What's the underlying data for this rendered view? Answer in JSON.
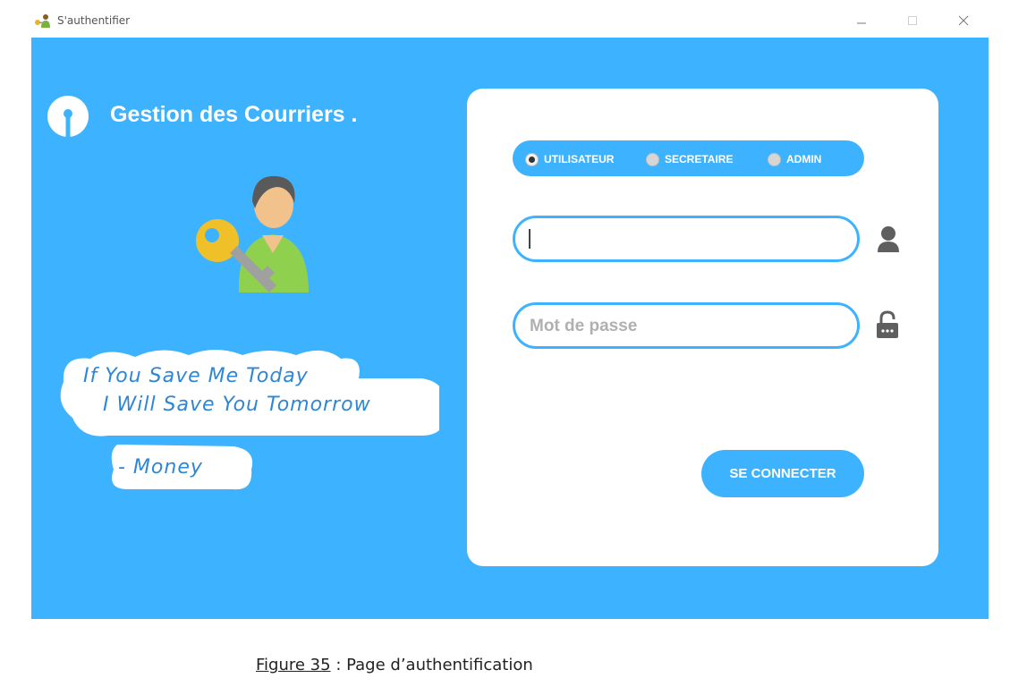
{
  "window": {
    "title": "S'authentifier",
    "icons": [
      "users-key-icon",
      "minimize-icon",
      "maximize-icon",
      "close-icon"
    ]
  },
  "brand": {
    "title": "Gestion des Courriers  .",
    "logo_icon": "keyhole-logo-icon",
    "illustration_icon": "user-key-icon"
  },
  "quote": {
    "line1": "If You Save Me Today",
    "line2": "I Will Save You Tomorrow",
    "author": "- Money"
  },
  "login": {
    "roles": [
      {
        "label": "UTILISATEUR",
        "selected": true
      },
      {
        "label": "SECRETAIRE",
        "selected": false
      },
      {
        "label": "ADMIN",
        "selected": false
      }
    ],
    "username": {
      "value": "",
      "placeholder": "",
      "icon": "user-icon"
    },
    "password": {
      "value": "",
      "placeholder": "Mot de passe",
      "icon": "lock-icon"
    },
    "submit_label": "SE CONNECTER"
  },
  "caption": {
    "label": "Figure 35",
    "text": " : Page d’authentification"
  },
  "colors": {
    "accent": "#3db3ff",
    "card": "#ffffff",
    "quote_text": "#2f86d6"
  }
}
